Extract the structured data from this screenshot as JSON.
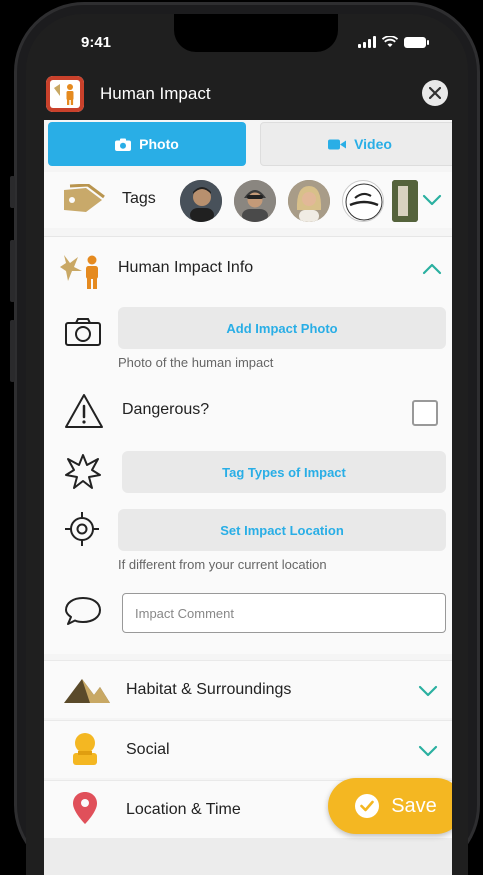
{
  "status_bar": {
    "time": "9:41"
  },
  "app_bar": {
    "title": "Human Impact"
  },
  "media_tabs": [
    {
      "label": "Photo",
      "icon": "camera-icon",
      "active": true
    },
    {
      "label": "Video",
      "icon": "video-camera-icon",
      "active": false
    }
  ],
  "tags": {
    "label": "Tags",
    "avatars": [
      {
        "icon": "person-avatar",
        "color": "#3c3c3c"
      },
      {
        "icon": "person-avatar",
        "color": "#6a5a4a"
      },
      {
        "icon": "person-avatar",
        "color": "#7a6a50"
      },
      {
        "icon": "logo-avatar",
        "color": "#ffffff"
      },
      {
        "icon": "photo-avatar",
        "color": "#4f5a3a"
      }
    ]
  },
  "impact_info": {
    "header": "Human Impact Info",
    "add_photo_label": "Add Impact Photo",
    "add_photo_hint": "Photo of the human impact",
    "dangerous_label": "Dangerous?",
    "dangerous_checked": false,
    "tag_types_label": "Tag Types of Impact",
    "set_location_label": "Set Impact Location",
    "set_location_hint": "If different from your current location",
    "comment_placeholder": "Impact Comment"
  },
  "sections": [
    {
      "label": "Habitat & Surroundings",
      "icon": "mountain-icon"
    },
    {
      "label": "Social",
      "icon": "social-badge-icon"
    },
    {
      "label": "Location & Time",
      "icon": "map-pin-icon"
    }
  ],
  "save_label": "Save",
  "colors": {
    "accent_blue": "#29aee6",
    "chevron_teal": "#2ab0a0",
    "save_yellow": "#f4b722"
  }
}
